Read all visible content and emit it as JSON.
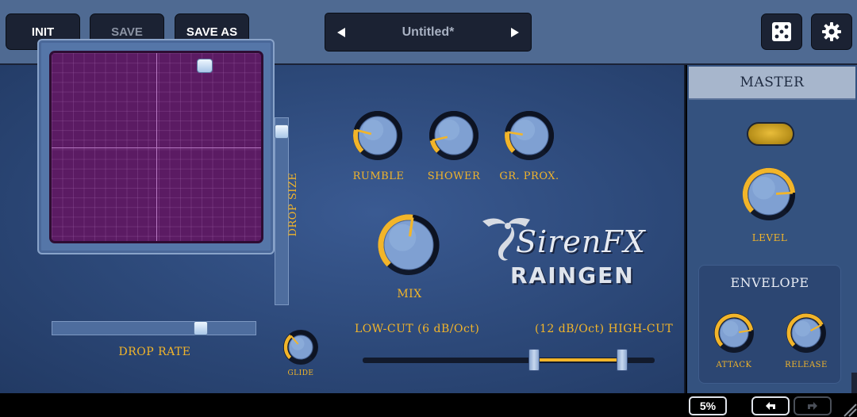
{
  "toolbar": {
    "init_label": "INIT",
    "save_label": "SAVE",
    "save_as_label": "SAVE AS",
    "preset_name": "Untitled*",
    "prev_icon": "left-triangle-icon",
    "next_icon": "right-triangle-icon",
    "random_icon": "dice-icon",
    "settings_icon": "gear-icon"
  },
  "xy_pad": {
    "x_label": "DROP RATE",
    "y_label": "DROP SIZE",
    "drop_rate": 0.74,
    "drop_size": 0.93,
    "grid_color": "#5b1b63"
  },
  "knobs": {
    "rumble": {
      "label": "RUMBLE",
      "value": 0.22
    },
    "shower": {
      "label": "SHOWER",
      "value": 0.12
    },
    "gr_prox": {
      "label": "GR. PROX.",
      "value": 0.2
    },
    "mix": {
      "label": "MIX",
      "value": 0.53
    },
    "glide": {
      "label": "GLIDE",
      "value": 0.35
    }
  },
  "logo": {
    "brand": "SirenFX",
    "product": "RAINGEN"
  },
  "filter": {
    "low_cut_label": "LOW-CUT (6 dB/Oct)",
    "high_cut_label": "(12 dB/Oct) HIGH-CUT"
  },
  "master": {
    "title": "MASTER",
    "level": {
      "label": "LEVEL",
      "value": 0.82
    },
    "envelope": {
      "title": "ENVELOPE",
      "attack": {
        "label": "ATTACK",
        "value": 0.8
      },
      "release": {
        "label": "RELEASE",
        "value": 0.73
      }
    }
  },
  "status": {
    "cpu": "5%",
    "undo_icon": "undo-arrow-icon",
    "redo_icon": "redo-arrow-icon",
    "resize_icon": "resize-grip-icon"
  },
  "colors": {
    "accent": "#f2b52a",
    "panel": "#2c4878",
    "button_bg": "#1b2233"
  }
}
